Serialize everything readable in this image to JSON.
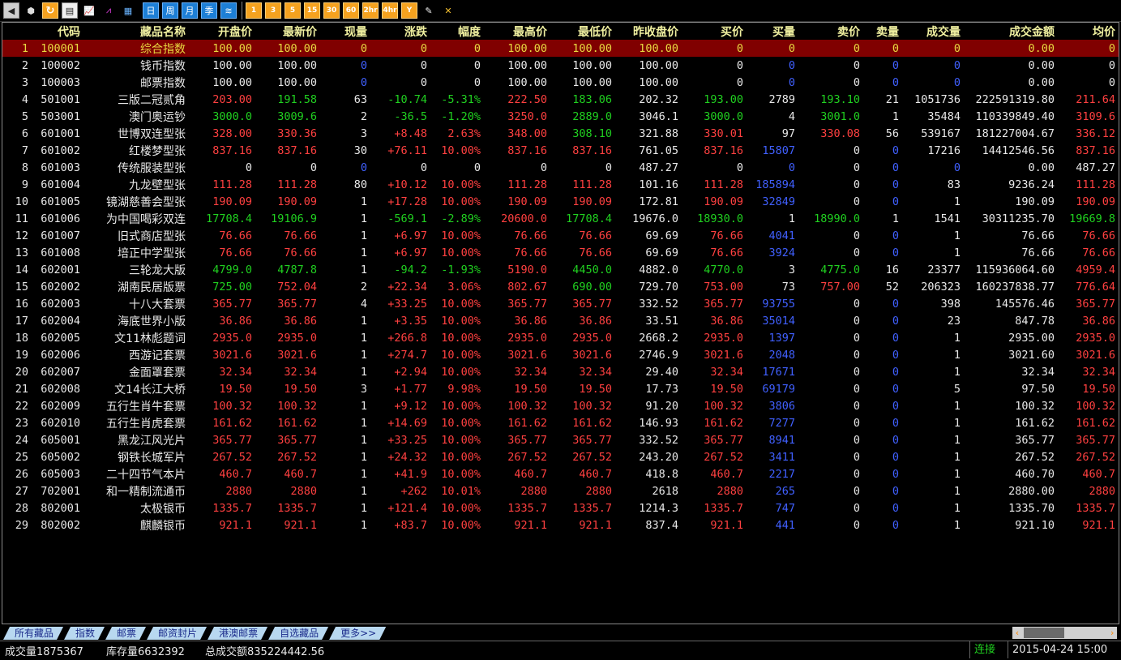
{
  "toolbar": {
    "icons": [
      "back-arrow-icon",
      "cube-icon",
      "refresh-icon",
      "clipboard-icon",
      "chart-icon",
      "kline-icon",
      "table-icon"
    ],
    "period_buttons": [
      "日",
      "周",
      "月",
      "季",
      "≋"
    ],
    "minute_buttons": [
      "1",
      "3",
      "5",
      "15",
      "30",
      "60",
      "2hr",
      "4hr",
      "Y"
    ],
    "tool_icons": [
      "edit-icon",
      "tools-icon"
    ]
  },
  "columns": [
    "",
    "代码",
    "藏品名称",
    "开盘价",
    "最新价",
    "现量",
    "涨跌",
    "幅度",
    "最高价",
    "最低价",
    "昨收盘价",
    "买价",
    "买量",
    "卖价",
    "卖量",
    "成交量",
    "成交金额",
    "均价"
  ],
  "rows": [
    {
      "no": "1",
      "code": "100001",
      "name": "综合指数",
      "open": "100.00",
      "last": "100.00",
      "vol": "0",
      "chg": "0",
      "pct": "0",
      "high": "100.00",
      "low": "100.00",
      "prev": "100.00",
      "bid": "0",
      "bidv": "0",
      "ask": "0",
      "askv": "0",
      "tvol": "0",
      "amt": "0.00",
      "avg": "0",
      "sel": true,
      "c": [
        "y",
        "y",
        "y",
        "y",
        "y",
        "y",
        "y",
        "y",
        "y",
        "y",
        "y",
        "y",
        "y",
        "y",
        "y"
      ]
    },
    {
      "no": "2",
      "code": "100002",
      "name": "钱币指数",
      "open": "100.00",
      "last": "100.00",
      "vol": "0",
      "chg": "0",
      "pct": "0",
      "high": "100.00",
      "low": "100.00",
      "prev": "100.00",
      "bid": "0",
      "bidv": "0",
      "ask": "0",
      "askv": "0",
      "tvol": "0",
      "amt": "0.00",
      "avg": "0",
      "c": [
        "w",
        "w",
        "b",
        "w",
        "w",
        "w",
        "w",
        "w",
        "w",
        "b",
        "w",
        "b",
        "b",
        "w",
        "w"
      ]
    },
    {
      "no": "3",
      "code": "100003",
      "name": "邮票指数",
      "open": "100.00",
      "last": "100.00",
      "vol": "0",
      "chg": "0",
      "pct": "0",
      "high": "100.00",
      "low": "100.00",
      "prev": "100.00",
      "bid": "0",
      "bidv": "0",
      "ask": "0",
      "askv": "0",
      "tvol": "0",
      "amt": "0.00",
      "avg": "0",
      "c": [
        "w",
        "w",
        "b",
        "w",
        "w",
        "w",
        "w",
        "w",
        "w",
        "b",
        "w",
        "b",
        "b",
        "w",
        "w"
      ]
    },
    {
      "no": "4",
      "code": "501001",
      "name": "三版二冠贰角",
      "open": "203.00",
      "last": "191.58",
      "vol": "63",
      "chg": "-10.74",
      "pct": "-5.31%",
      "high": "222.50",
      "low": "183.06",
      "prev": "202.32",
      "bid": "193.00",
      "bidv": "2789",
      "ask": "193.10",
      "askv": "21",
      "tvol": "1051736",
      "amt": "222591319.80",
      "avg": "211.64",
      "c": [
        "r",
        "g",
        "w",
        "g",
        "g",
        "r",
        "g",
        "w",
        "g",
        "w",
        "g",
        "w",
        "w",
        "w",
        "r"
      ]
    },
    {
      "no": "5",
      "code": "503001",
      "name": "澳门奥运钞",
      "open": "3000.0",
      "last": "3009.6",
      "vol": "2",
      "chg": "-36.5",
      "pct": "-1.20%",
      "high": "3250.0",
      "low": "2889.0",
      "prev": "3046.1",
      "bid": "3000.0",
      "bidv": "4",
      "ask": "3001.0",
      "askv": "1",
      "tvol": "35484",
      "amt": "110339849.40",
      "avg": "3109.6",
      "c": [
        "g",
        "g",
        "w",
        "g",
        "g",
        "r",
        "g",
        "w",
        "g",
        "w",
        "g",
        "w",
        "w",
        "w",
        "r"
      ]
    },
    {
      "no": "6",
      "code": "601001",
      "name": "世博双连型张",
      "open": "328.00",
      "last": "330.36",
      "vol": "3",
      "chg": "+8.48",
      "pct": "2.63%",
      "high": "348.00",
      "low": "308.10",
      "prev": "321.88",
      "bid": "330.01",
      "bidv": "97",
      "ask": "330.08",
      "askv": "56",
      "tvol": "539167",
      "amt": "181227004.67",
      "avg": "336.12",
      "c": [
        "r",
        "r",
        "w",
        "r",
        "r",
        "r",
        "g",
        "w",
        "r",
        "w",
        "r",
        "w",
        "w",
        "w",
        "r"
      ]
    },
    {
      "no": "7",
      "code": "601002",
      "name": "红楼梦型张",
      "open": "837.16",
      "last": "837.16",
      "vol": "30",
      "chg": "+76.11",
      "pct": "10.00%",
      "high": "837.16",
      "low": "837.16",
      "prev": "761.05",
      "bid": "837.16",
      "bidv": "15807",
      "ask": "0",
      "askv": "0",
      "tvol": "17216",
      "amt": "14412546.56",
      "avg": "837.16",
      "c": [
        "r",
        "r",
        "w",
        "r",
        "r",
        "r",
        "r",
        "w",
        "r",
        "b",
        "w",
        "b",
        "w",
        "w",
        "r"
      ]
    },
    {
      "no": "8",
      "code": "601003",
      "name": "传统服装型张",
      "open": "0",
      "last": "0",
      "vol": "0",
      "chg": "0",
      "pct": "0",
      "high": "0",
      "low": "0",
      "prev": "487.27",
      "bid": "0",
      "bidv": "0",
      "ask": "0",
      "askv": "0",
      "tvol": "0",
      "amt": "0.00",
      "avg": "487.27",
      "c": [
        "w",
        "w",
        "b",
        "w",
        "w",
        "w",
        "w",
        "w",
        "w",
        "b",
        "w",
        "b",
        "b",
        "w",
        "w"
      ]
    },
    {
      "no": "9",
      "code": "601004",
      "name": "九龙壁型张",
      "open": "111.28",
      "last": "111.28",
      "vol": "80",
      "chg": "+10.12",
      "pct": "10.00%",
      "high": "111.28",
      "low": "111.28",
      "prev": "101.16",
      "bid": "111.28",
      "bidv": "185894",
      "ask": "0",
      "askv": "0",
      "tvol": "83",
      "amt": "9236.24",
      "avg": "111.28",
      "c": [
        "r",
        "r",
        "w",
        "r",
        "r",
        "r",
        "r",
        "w",
        "r",
        "b",
        "w",
        "b",
        "w",
        "w",
        "r"
      ]
    },
    {
      "no": "10",
      "code": "601005",
      "name": "镜湖慈善会型张",
      "open": "190.09",
      "last": "190.09",
      "vol": "1",
      "chg": "+17.28",
      "pct": "10.00%",
      "high": "190.09",
      "low": "190.09",
      "prev": "172.81",
      "bid": "190.09",
      "bidv": "32849",
      "ask": "0",
      "askv": "0",
      "tvol": "1",
      "amt": "190.09",
      "avg": "190.09",
      "c": [
        "r",
        "r",
        "w",
        "r",
        "r",
        "r",
        "r",
        "w",
        "r",
        "b",
        "w",
        "b",
        "w",
        "w",
        "r"
      ]
    },
    {
      "no": "11",
      "code": "601006",
      "name": "为中国喝彩双连",
      "open": "17708.4",
      "last": "19106.9",
      "vol": "1",
      "chg": "-569.1",
      "pct": "-2.89%",
      "high": "20600.0",
      "low": "17708.4",
      "prev": "19676.0",
      "bid": "18930.0",
      "bidv": "1",
      "ask": "18990.0",
      "askv": "1",
      "tvol": "1541",
      "amt": "30311235.70",
      "avg": "19669.8",
      "c": [
        "g",
        "g",
        "w",
        "g",
        "g",
        "r",
        "g",
        "w",
        "g",
        "w",
        "g",
        "w",
        "w",
        "w",
        "g"
      ]
    },
    {
      "no": "12",
      "code": "601007",
      "name": "旧式商店型张",
      "open": "76.66",
      "last": "76.66",
      "vol": "1",
      "chg": "+6.97",
      "pct": "10.00%",
      "high": "76.66",
      "low": "76.66",
      "prev": "69.69",
      "bid": "76.66",
      "bidv": "4041",
      "ask": "0",
      "askv": "0",
      "tvol": "1",
      "amt": "76.66",
      "avg": "76.66",
      "c": [
        "r",
        "r",
        "w",
        "r",
        "r",
        "r",
        "r",
        "w",
        "r",
        "b",
        "w",
        "b",
        "w",
        "w",
        "r"
      ]
    },
    {
      "no": "13",
      "code": "601008",
      "name": "培正中学型张",
      "open": "76.66",
      "last": "76.66",
      "vol": "1",
      "chg": "+6.97",
      "pct": "10.00%",
      "high": "76.66",
      "low": "76.66",
      "prev": "69.69",
      "bid": "76.66",
      "bidv": "3924",
      "ask": "0",
      "askv": "0",
      "tvol": "1",
      "amt": "76.66",
      "avg": "76.66",
      "c": [
        "r",
        "r",
        "w",
        "r",
        "r",
        "r",
        "r",
        "w",
        "r",
        "b",
        "w",
        "b",
        "w",
        "w",
        "r"
      ]
    },
    {
      "no": "14",
      "code": "602001",
      "name": "三轮龙大版",
      "open": "4799.0",
      "last": "4787.8",
      "vol": "1",
      "chg": "-94.2",
      "pct": "-1.93%",
      "high": "5190.0",
      "low": "4450.0",
      "prev": "4882.0",
      "bid": "4770.0",
      "bidv": "3",
      "ask": "4775.0",
      "askv": "16",
      "tvol": "23377",
      "amt": "115936064.60",
      "avg": "4959.4",
      "c": [
        "g",
        "g",
        "w",
        "g",
        "g",
        "r",
        "g",
        "w",
        "g",
        "w",
        "g",
        "w",
        "w",
        "w",
        "r"
      ]
    },
    {
      "no": "15",
      "code": "602002",
      "name": "湖南民居版票",
      "open": "725.00",
      "last": "752.04",
      "vol": "2",
      "chg": "+22.34",
      "pct": "3.06%",
      "high": "802.67",
      "low": "690.00",
      "prev": "729.70",
      "bid": "753.00",
      "bidv": "73",
      "ask": "757.00",
      "askv": "52",
      "tvol": "206323",
      "amt": "160237838.77",
      "avg": "776.64",
      "c": [
        "g",
        "r",
        "w",
        "r",
        "r",
        "r",
        "g",
        "w",
        "r",
        "w",
        "r",
        "w",
        "w",
        "w",
        "r"
      ]
    },
    {
      "no": "16",
      "code": "602003",
      "name": "十八大套票",
      "open": "365.77",
      "last": "365.77",
      "vol": "4",
      "chg": "+33.25",
      "pct": "10.00%",
      "high": "365.77",
      "low": "365.77",
      "prev": "332.52",
      "bid": "365.77",
      "bidv": "93755",
      "ask": "0",
      "askv": "0",
      "tvol": "398",
      "amt": "145576.46",
      "avg": "365.77",
      "c": [
        "r",
        "r",
        "w",
        "r",
        "r",
        "r",
        "r",
        "w",
        "r",
        "b",
        "w",
        "b",
        "w",
        "w",
        "r"
      ]
    },
    {
      "no": "17",
      "code": "602004",
      "name": "海底世界小版",
      "open": "36.86",
      "last": "36.86",
      "vol": "1",
      "chg": "+3.35",
      "pct": "10.00%",
      "high": "36.86",
      "low": "36.86",
      "prev": "33.51",
      "bid": "36.86",
      "bidv": "35014",
      "ask": "0",
      "askv": "0",
      "tvol": "23",
      "amt": "847.78",
      "avg": "36.86",
      "c": [
        "r",
        "r",
        "w",
        "r",
        "r",
        "r",
        "r",
        "w",
        "r",
        "b",
        "w",
        "b",
        "w",
        "w",
        "r"
      ]
    },
    {
      "no": "18",
      "code": "602005",
      "name": "文11林彪题词",
      "open": "2935.0",
      "last": "2935.0",
      "vol": "1",
      "chg": "+266.8",
      "pct": "10.00%",
      "high": "2935.0",
      "low": "2935.0",
      "prev": "2668.2",
      "bid": "2935.0",
      "bidv": "1397",
      "ask": "0",
      "askv": "0",
      "tvol": "1",
      "amt": "2935.00",
      "avg": "2935.0",
      "c": [
        "r",
        "r",
        "w",
        "r",
        "r",
        "r",
        "r",
        "w",
        "r",
        "b",
        "w",
        "b",
        "w",
        "w",
        "r"
      ]
    },
    {
      "no": "19",
      "code": "602006",
      "name": "西游记套票",
      "open": "3021.6",
      "last": "3021.6",
      "vol": "1",
      "chg": "+274.7",
      "pct": "10.00%",
      "high": "3021.6",
      "low": "3021.6",
      "prev": "2746.9",
      "bid": "3021.6",
      "bidv": "2048",
      "ask": "0",
      "askv": "0",
      "tvol": "1",
      "amt": "3021.60",
      "avg": "3021.6",
      "c": [
        "r",
        "r",
        "w",
        "r",
        "r",
        "r",
        "r",
        "w",
        "r",
        "b",
        "w",
        "b",
        "w",
        "w",
        "r"
      ]
    },
    {
      "no": "20",
      "code": "602007",
      "name": "金面罩套票",
      "open": "32.34",
      "last": "32.34",
      "vol": "1",
      "chg": "+2.94",
      "pct": "10.00%",
      "high": "32.34",
      "low": "32.34",
      "prev": "29.40",
      "bid": "32.34",
      "bidv": "17671",
      "ask": "0",
      "askv": "0",
      "tvol": "1",
      "amt": "32.34",
      "avg": "32.34",
      "c": [
        "r",
        "r",
        "w",
        "r",
        "r",
        "r",
        "r",
        "w",
        "r",
        "b",
        "w",
        "b",
        "w",
        "w",
        "r"
      ]
    },
    {
      "no": "21",
      "code": "602008",
      "name": "文14长江大桥",
      "open": "19.50",
      "last": "19.50",
      "vol": "3",
      "chg": "+1.77",
      "pct": "9.98%",
      "high": "19.50",
      "low": "19.50",
      "prev": "17.73",
      "bid": "19.50",
      "bidv": "69179",
      "ask": "0",
      "askv": "0",
      "tvol": "5",
      "amt": "97.50",
      "avg": "19.50",
      "c": [
        "r",
        "r",
        "w",
        "r",
        "r",
        "r",
        "r",
        "w",
        "r",
        "b",
        "w",
        "b",
        "w",
        "w",
        "r"
      ]
    },
    {
      "no": "22",
      "code": "602009",
      "name": "五行生肖牛套票",
      "open": "100.32",
      "last": "100.32",
      "vol": "1",
      "chg": "+9.12",
      "pct": "10.00%",
      "high": "100.32",
      "low": "100.32",
      "prev": "91.20",
      "bid": "100.32",
      "bidv": "3806",
      "ask": "0",
      "askv": "0",
      "tvol": "1",
      "amt": "100.32",
      "avg": "100.32",
      "c": [
        "r",
        "r",
        "w",
        "r",
        "r",
        "r",
        "r",
        "w",
        "r",
        "b",
        "w",
        "b",
        "w",
        "w",
        "r"
      ]
    },
    {
      "no": "23",
      "code": "602010",
      "name": "五行生肖虎套票",
      "open": "161.62",
      "last": "161.62",
      "vol": "1",
      "chg": "+14.69",
      "pct": "10.00%",
      "high": "161.62",
      "low": "161.62",
      "prev": "146.93",
      "bid": "161.62",
      "bidv": "7277",
      "ask": "0",
      "askv": "0",
      "tvol": "1",
      "amt": "161.62",
      "avg": "161.62",
      "c": [
        "r",
        "r",
        "w",
        "r",
        "r",
        "r",
        "r",
        "w",
        "r",
        "b",
        "w",
        "b",
        "w",
        "w",
        "r"
      ]
    },
    {
      "no": "24",
      "code": "605001",
      "name": "黑龙江风光片",
      "open": "365.77",
      "last": "365.77",
      "vol": "1",
      "chg": "+33.25",
      "pct": "10.00%",
      "high": "365.77",
      "low": "365.77",
      "prev": "332.52",
      "bid": "365.77",
      "bidv": "8941",
      "ask": "0",
      "askv": "0",
      "tvol": "1",
      "amt": "365.77",
      "avg": "365.77",
      "c": [
        "r",
        "r",
        "w",
        "r",
        "r",
        "r",
        "r",
        "w",
        "r",
        "b",
        "w",
        "b",
        "w",
        "w",
        "r"
      ]
    },
    {
      "no": "25",
      "code": "605002",
      "name": "钢铁长城军片",
      "open": "267.52",
      "last": "267.52",
      "vol": "1",
      "chg": "+24.32",
      "pct": "10.00%",
      "high": "267.52",
      "low": "267.52",
      "prev": "243.20",
      "bid": "267.52",
      "bidv": "3411",
      "ask": "0",
      "askv": "0",
      "tvol": "1",
      "amt": "267.52",
      "avg": "267.52",
      "c": [
        "r",
        "r",
        "w",
        "r",
        "r",
        "r",
        "r",
        "w",
        "r",
        "b",
        "w",
        "b",
        "w",
        "w",
        "r"
      ]
    },
    {
      "no": "26",
      "code": "605003",
      "name": "二十四节气本片",
      "open": "460.7",
      "last": "460.7",
      "vol": "1",
      "chg": "+41.9",
      "pct": "10.00%",
      "high": "460.7",
      "low": "460.7",
      "prev": "418.8",
      "bid": "460.7",
      "bidv": "2217",
      "ask": "0",
      "askv": "0",
      "tvol": "1",
      "amt": "460.70",
      "avg": "460.7",
      "c": [
        "r",
        "r",
        "w",
        "r",
        "r",
        "r",
        "r",
        "w",
        "r",
        "b",
        "w",
        "b",
        "w",
        "w",
        "r"
      ]
    },
    {
      "no": "27",
      "code": "702001",
      "name": "和一精制流通币",
      "open": "2880",
      "last": "2880",
      "vol": "1",
      "chg": "+262",
      "pct": "10.01%",
      "high": "2880",
      "low": "2880",
      "prev": "2618",
      "bid": "2880",
      "bidv": "265",
      "ask": "0",
      "askv": "0",
      "tvol": "1",
      "amt": "2880.00",
      "avg": "2880",
      "c": [
        "r",
        "r",
        "w",
        "r",
        "r",
        "r",
        "r",
        "w",
        "r",
        "b",
        "w",
        "b",
        "w",
        "w",
        "r"
      ]
    },
    {
      "no": "28",
      "code": "802001",
      "name": "太极银币",
      "open": "1335.7",
      "last": "1335.7",
      "vol": "1",
      "chg": "+121.4",
      "pct": "10.00%",
      "high": "1335.7",
      "low": "1335.7",
      "prev": "1214.3",
      "bid": "1335.7",
      "bidv": "747",
      "ask": "0",
      "askv": "0",
      "tvol": "1",
      "amt": "1335.70",
      "avg": "1335.7",
      "c": [
        "r",
        "r",
        "w",
        "r",
        "r",
        "r",
        "r",
        "w",
        "r",
        "b",
        "w",
        "b",
        "w",
        "w",
        "r"
      ]
    },
    {
      "no": "29",
      "code": "802002",
      "name": "麒麟银币",
      "open": "921.1",
      "last": "921.1",
      "vol": "1",
      "chg": "+83.7",
      "pct": "10.00%",
      "high": "921.1",
      "low": "921.1",
      "prev": "837.4",
      "bid": "921.1",
      "bidv": "441",
      "ask": "0",
      "askv": "0",
      "tvol": "1",
      "amt": "921.10",
      "avg": "921.1",
      "c": [
        "r",
        "r",
        "w",
        "r",
        "r",
        "r",
        "r",
        "w",
        "r",
        "b",
        "w",
        "b",
        "w",
        "w",
        "r"
      ]
    }
  ],
  "tabs": [
    "所有藏品",
    "指数",
    "邮票",
    "邮资封片",
    "港澳邮票",
    "自选藏品",
    "更多>>"
  ],
  "status": {
    "volume_label": "成交量",
    "volume": "1875367",
    "stock_label": "库存量",
    "stock": "6632392",
    "amount_label": "总成交额",
    "amount": "835224442.56",
    "connection": "连接",
    "datetime": "2015-04-24 15:00"
  },
  "colors": {
    "up": "#ff4040",
    "down": "#20d020",
    "header": "#f0f0a0",
    "selected_row": "#800000",
    "volume": "#4060ff"
  }
}
